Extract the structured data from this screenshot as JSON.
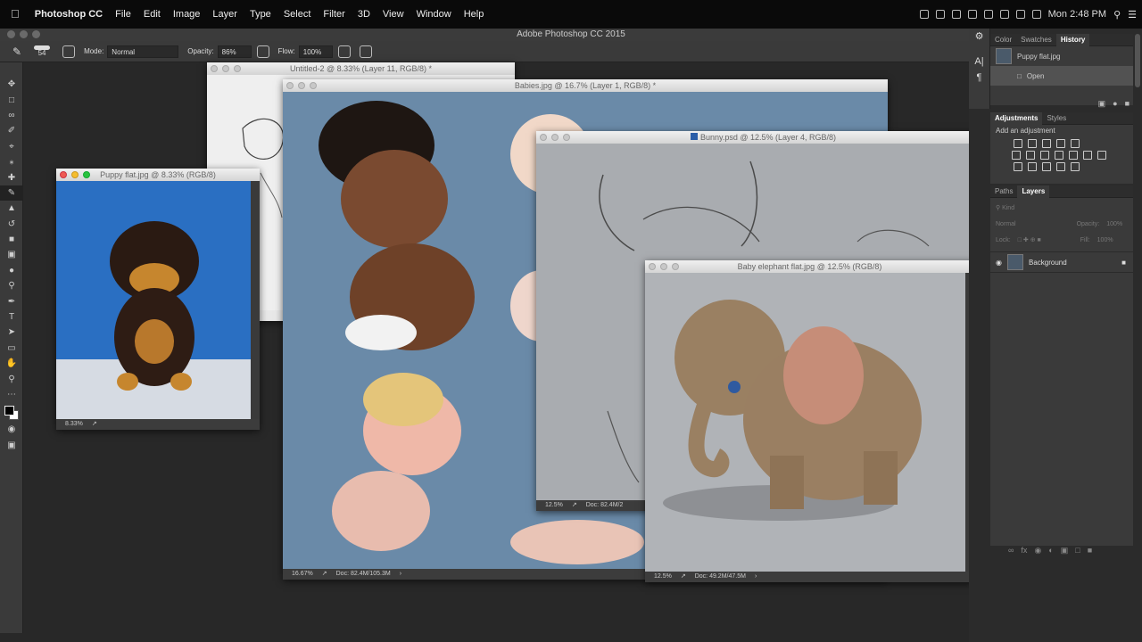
{
  "menubar": {
    "apple": "",
    "app": "Photoshop CC",
    "items": [
      "File",
      "Edit",
      "Image",
      "Layer",
      "Type",
      "Select",
      "Filter",
      "3D",
      "View",
      "Window",
      "Help"
    ],
    "clock": "Mon 2:48 PM"
  },
  "window_title": "Adobe Photoshop CC 2015",
  "options": {
    "brush_size": "54",
    "mode_label": "Mode:",
    "mode_value": "Normal",
    "opacity_label": "Opacity:",
    "opacity_value": "86%",
    "flow_label": "Flow:",
    "flow_value": "100%"
  },
  "tools": [
    "move",
    "marquee",
    "lasso",
    "quick-select",
    "crop",
    "eyedropper",
    "healing",
    "brush",
    "stamp",
    "history-brush",
    "eraser",
    "gradient",
    "blur",
    "dodge",
    "pen",
    "type",
    "path-select",
    "shape",
    "hand",
    "zoom",
    "more"
  ],
  "docs": {
    "untitled": {
      "title": "Untitled-2 @ 8.33% (Layer 11, RGB/8) *"
    },
    "babies": {
      "title": "Babies.jpg @ 16.7% (Layer 1, RGB/8) *",
      "zoom": "16.67%",
      "doc": "Doc: 82.4M/105.3M"
    },
    "puppy": {
      "title": "Puppy flat.jpg @ 8.33% (RGB/8)",
      "zoom": "8.33%"
    },
    "bunny": {
      "title": "Bunny.psd @ 12.5% (Layer 4, RGB/8)",
      "zoom": "12.5%",
      "doc": "Doc: 82.4M/2"
    },
    "elephant": {
      "title": "Baby elephant flat.jpg @ 12.5% (RGB/8)",
      "zoom": "12.5%",
      "doc": "Doc: 49.2M/47.5M"
    }
  },
  "history_panel": {
    "tabs": [
      "Color",
      "Swatches",
      "History"
    ],
    "snapshot": "Puppy flat.jpg",
    "step": "Open"
  },
  "adjustments_panel": {
    "tabs": [
      "Adjustments",
      "Styles"
    ],
    "hint": "Add an adjustment"
  },
  "layers_panel": {
    "tabs": [
      "Paths",
      "Layers"
    ],
    "kind": "Kind",
    "blend": "Normal",
    "opacity_label": "Opacity:",
    "opacity_value": "100%",
    "lock_label": "Lock:",
    "fill_label": "Fill:",
    "fill_value": "100%",
    "layer_name": "Background"
  },
  "colors": {
    "accent_red": "#ee5a53",
    "accent_yellow": "#f5bd2f",
    "accent_green": "#29c23f",
    "panel_bg": "#3a3a3a"
  }
}
